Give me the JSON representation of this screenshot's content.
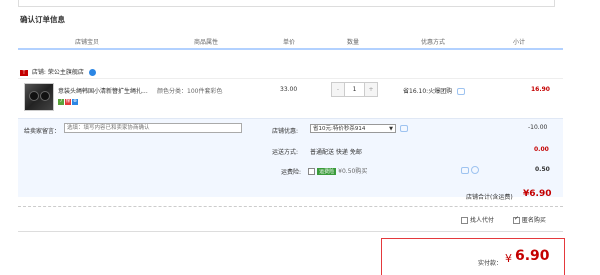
{
  "section_title": "确认订单信息",
  "headers": {
    "shop_item": "店铺宝贝",
    "attributes": "商品属性",
    "unit_price": "单价",
    "quantity": "数量",
    "promotion": "优惠方式",
    "subtotal": "小计"
  },
  "shop": {
    "label": "店铺:",
    "name": "荣公主旗舰店"
  },
  "item": {
    "title": "意装头绳韩国小清新簪扩生绳扎...",
    "spec": "颜色分类：100件套彩色",
    "price": "33.00",
    "quantity": "1",
    "minus": "-",
    "plus": "+",
    "promo": "省16.10:火爆团购",
    "subtotal": "16.90",
    "badges": [
      "7",
      "保",
      "⊕"
    ]
  },
  "memo": {
    "label": "给卖家留言：",
    "placeholder": "选填：填写内容已和卖家协商确认"
  },
  "store_promo": {
    "label": "店铺优惠:",
    "selected": "省10元:特价秒杀914",
    "amount": "-10.00"
  },
  "shipping": {
    "label": "运送方式:",
    "value": "普通配送 快递 免邮",
    "amount": "0.00"
  },
  "insurance": {
    "label": "运费险:",
    "tag": "运费险",
    "text": "¥0.50购买",
    "amount": "0.50"
  },
  "store_total": {
    "label": "店铺合计(含运费)",
    "value": "¥6.90"
  },
  "options": {
    "anonymous": "找人代付",
    "anonymous_checked": false,
    "anon_buy": "匿名购买",
    "anon_buy_checked": true
  },
  "payment": {
    "label": "实付款：",
    "currency": "¥",
    "value": "6.90"
  },
  "colors": {
    "accent_red": "#c40000",
    "header_line": "#b2d1ff",
    "panel_bg": "#f2f7ff"
  }
}
